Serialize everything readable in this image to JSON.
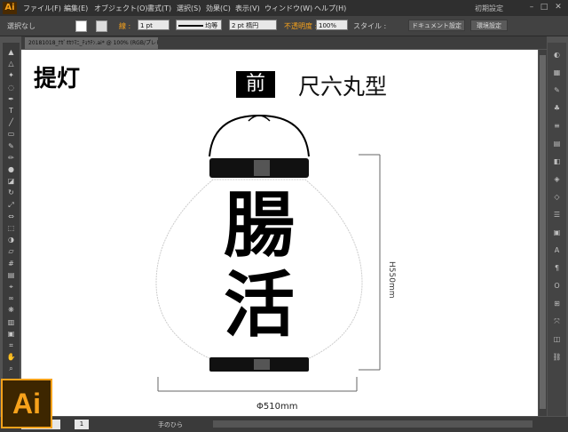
{
  "app": {
    "logo": "Ai",
    "menus": [
      "ファイル(F)",
      "編集(E)",
      "オブジェクト(O)",
      "書式(T)",
      "選択(S)",
      "効果(C)",
      "表示(V)",
      "ウィンドウ(W)",
      "ヘルプ(H)"
    ],
    "workspace": "初期設定"
  },
  "control_bar": {
    "selection": "選択なし",
    "stroke_label": "線 :",
    "stroke_weight": "1 pt",
    "stroke_profile": "均等",
    "brush": "2 pt 楕円",
    "opacity_label": "不透明度 :",
    "opacity_value": "100%",
    "style_label": "スタイル :",
    "doc_setup": "ドキュメント設定",
    "prefs": "環境設定",
    "fill_color": "#ffffff",
    "accent_color": "#f7a21b"
  },
  "document_tab": {
    "title": "20181018_ﾅｶﾞｵｶﾂﾏﾆ_ﾁｮｳﾁﾝ.ai* @ 100% (RGB/プレビュー)"
  },
  "artboard": {
    "heading": "提灯",
    "side_label": "前",
    "size_name": "尺六丸型",
    "lantern_text": "腸活",
    "height_dim": "H550mm",
    "width_dim": "Φ510mm"
  },
  "status": {
    "zoom": "100%",
    "page": "1",
    "tool": "手のひら"
  },
  "icons": {
    "tools": [
      "selection-icon",
      "direct-selection-icon",
      "magic-wand-icon",
      "lasso-icon",
      "pen-icon",
      "type-icon",
      "line-icon",
      "rectangle-icon",
      "paintbrush-icon",
      "pencil-icon",
      "blob-brush-icon",
      "eraser-icon",
      "rotate-icon",
      "scale-icon",
      "width-icon",
      "free-transform-icon",
      "shape-builder-icon",
      "perspective-icon",
      "mesh-icon",
      "gradient-icon",
      "eyedropper-icon",
      "blend-icon",
      "symbol-sprayer-icon",
      "column-graph-icon",
      "artboard-icon",
      "slice-icon",
      "hand-icon",
      "zoom-icon"
    ],
    "panels": [
      "color-panel-icon",
      "swatches-panel-icon",
      "brushes-panel-icon",
      "symbols-panel-icon",
      "stroke-panel-icon",
      "gradient-panel-icon",
      "transparency-panel-icon",
      "appearance-panel-icon",
      "graphic-styles-panel-icon",
      "layers-panel-icon",
      "artboards-panel-icon",
      "character-panel-icon",
      "paragraph-panel-icon",
      "opentype-panel-icon",
      "align-panel-icon",
      "transform-panel-icon",
      "pathfinder-panel-icon",
      "links-panel-icon"
    ]
  }
}
